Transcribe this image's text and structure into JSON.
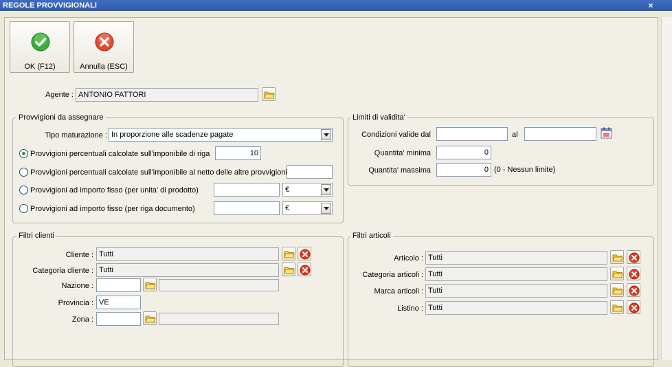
{
  "window": {
    "title": "REGOLE PROVVIGIONALI",
    "close_glyph": "×"
  },
  "toolbar": {
    "ok": {
      "label": "OK (F12)",
      "icon": "check-icon",
      "color": "#2e9e2e"
    },
    "cancel": {
      "label": "Annulla (ESC)",
      "icon": "cancel-icon",
      "color": "#d83a22"
    }
  },
  "agent": {
    "label": "Agente :",
    "value": "ANTONIO FATTORI"
  },
  "provvigioni": {
    "title": "Provvigioni da assegnare",
    "maturazione_label": "Tipo maturazione :",
    "maturazione_value": "In proporzione alle scadenze pagate",
    "options": [
      {
        "label": "Provvigioni percentuali calcolate sull'imponibile di riga",
        "value": "10",
        "selected": true
      },
      {
        "label": "Provvigioni percentuali calcolate sull'imponibile al netto delle altre provvigioni",
        "value": "",
        "selected": false
      },
      {
        "label": "Provvigioni ad importo fisso (per unita' di prodotto)",
        "value": "",
        "currency": "€",
        "selected": false
      },
      {
        "label": "Provvigioni ad importo fisso (per riga documento)",
        "value": "",
        "currency": "€",
        "selected": false
      }
    ]
  },
  "limiti": {
    "title": "Limiti di validita'",
    "condizioni_label": "Condizioni valide dal",
    "dal_value": "",
    "al_label": "al",
    "al_value": "",
    "qmin_label": "Quantita' minima",
    "qmin_value": "0",
    "qmax_label": "Quantita' massima",
    "qmax_value": "0",
    "qmax_note": "(0 - Nessun limite)"
  },
  "filtri_clienti": {
    "title": "Filtri clienti",
    "cliente_label": "Cliente :",
    "cliente_value": "Tutti",
    "categoria_label": "Categoria cliente :",
    "categoria_value": "Tutti",
    "nazione_label": "Nazione :",
    "nazione_value": "",
    "nazione_desc": "",
    "provincia_label": "Provincia :",
    "provincia_value": "VE",
    "zona_label": "Zona :",
    "zona_value": "",
    "zona_desc": ""
  },
  "filtri_articoli": {
    "title": "Filtri articoli",
    "articolo_label": "Articolo :",
    "articolo_value": "Tutti",
    "categoria_label": "Categoria articoli :",
    "categoria_value": "Tutti",
    "marca_label": "Marca articoli :",
    "marca_value": "Tutti",
    "listino_label": "Listino :",
    "listino_value": "Tutti"
  }
}
